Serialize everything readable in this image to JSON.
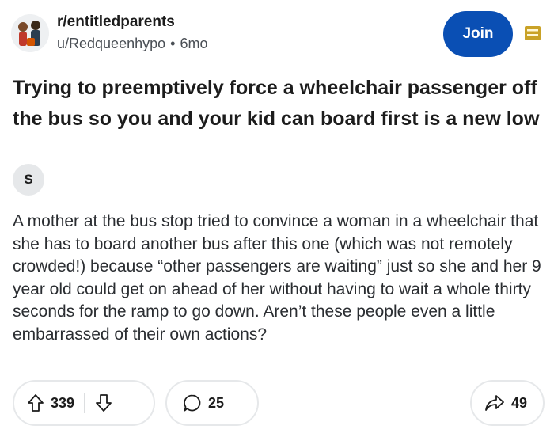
{
  "header": {
    "subreddit": "r/entitledparents",
    "username": "u/Redqueenhypo",
    "separator": "•",
    "age": "6mo",
    "join_label": "Join"
  },
  "post": {
    "title": "Trying to preemptively force a wheelchair passenger off the bus so you and your kid can board first is a new low",
    "flair": "S",
    "body": "A mother at the bus stop tried to convince a woman in a wheelchair that she has to board another bus after this one (which was not remotely crowded!) because “other passengers are waiting” just so she and her 9 year old could get on ahead of her without having to wait a whole thirty seconds for the ramp to go down. Aren’t these people even a little embarrassed of their own actions?"
  },
  "actions": {
    "upvotes": "339",
    "comments": "25",
    "shares": "49"
  },
  "icons": {
    "avatar": "subreddit-avatar",
    "menu": "collapse-menu-icon",
    "upvote": "upvote-arrow-icon",
    "downvote": "downvote-arrow-icon",
    "comment": "comment-bubble-icon",
    "share": "share-arrow-icon"
  },
  "colors": {
    "accent": "#0a4fb4",
    "menu_icon": "#c9a227",
    "border": "#e6e8ea"
  }
}
